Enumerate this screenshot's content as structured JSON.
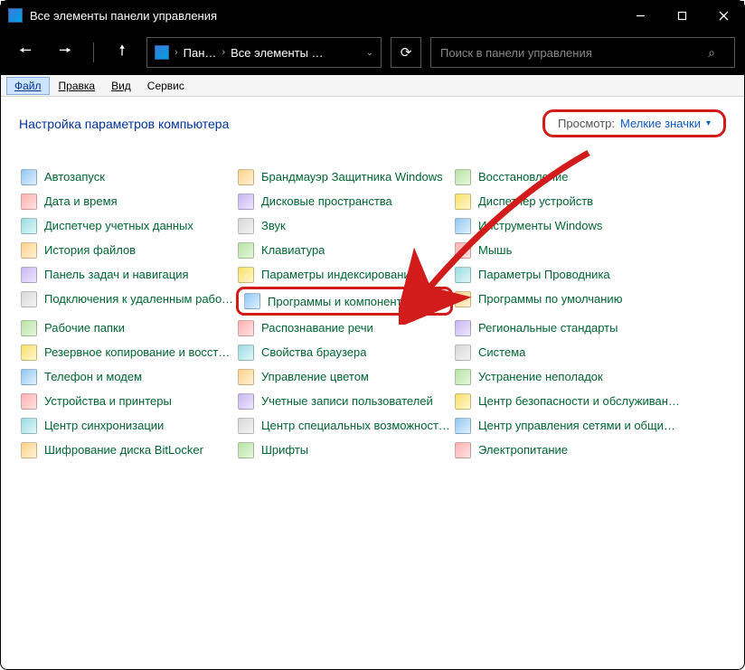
{
  "window": {
    "title": "Все элементы панели управления"
  },
  "breadcrumb": {
    "seg1": "Пан…",
    "seg2": "Все элементы …"
  },
  "search": {
    "placeholder": "Поиск в панели управления"
  },
  "menu": {
    "file": "Файл",
    "edit": "Правка",
    "view": "Вид",
    "service": "Сервис"
  },
  "header": {
    "title": "Настройка параметров компьютера"
  },
  "view": {
    "label": "Просмотр:",
    "value": "Мелкие значки"
  },
  "items": {
    "col1": [
      "Автозапуск",
      "Дата и время",
      "Диспетчер учетных данных",
      "История файлов",
      "Панель задач и навигация",
      "Подключения к удаленным рабоч…",
      "Рабочие папки",
      "Резервное копирование и восстан…",
      "Телефон и модем",
      "Устройства и принтеры",
      "Центр синхронизации",
      "Шифрование диска BitLocker"
    ],
    "col2": [
      "Брандмауэр Защитника Windows",
      "Дисковые пространства",
      "Звук",
      "Клавиатура",
      "Параметры индексирования",
      "Программы и компоненты",
      "Распознавание речи",
      "Свойства браузера",
      "Управление цветом",
      "Учетные записи пользователей",
      "Центр специальных возможностей",
      "Шрифты"
    ],
    "col3": [
      "Восстановление",
      "Диспетчер устройств",
      "Инструменты Windows",
      "Мышь",
      "Параметры Проводника",
      "Программы по умолчанию",
      "Региональные стандарты",
      "Система",
      "Устранение неполадок",
      "Центр безопасности и обслуживан…",
      "Центр управления сетями и общи…",
      "Электропитание"
    ]
  },
  "highlight_index": {
    "col": 2,
    "row": 5
  },
  "icon_classes": [
    "c1",
    "c2",
    "c3",
    "c4",
    "c5",
    "c6",
    "c7",
    "c8"
  ]
}
